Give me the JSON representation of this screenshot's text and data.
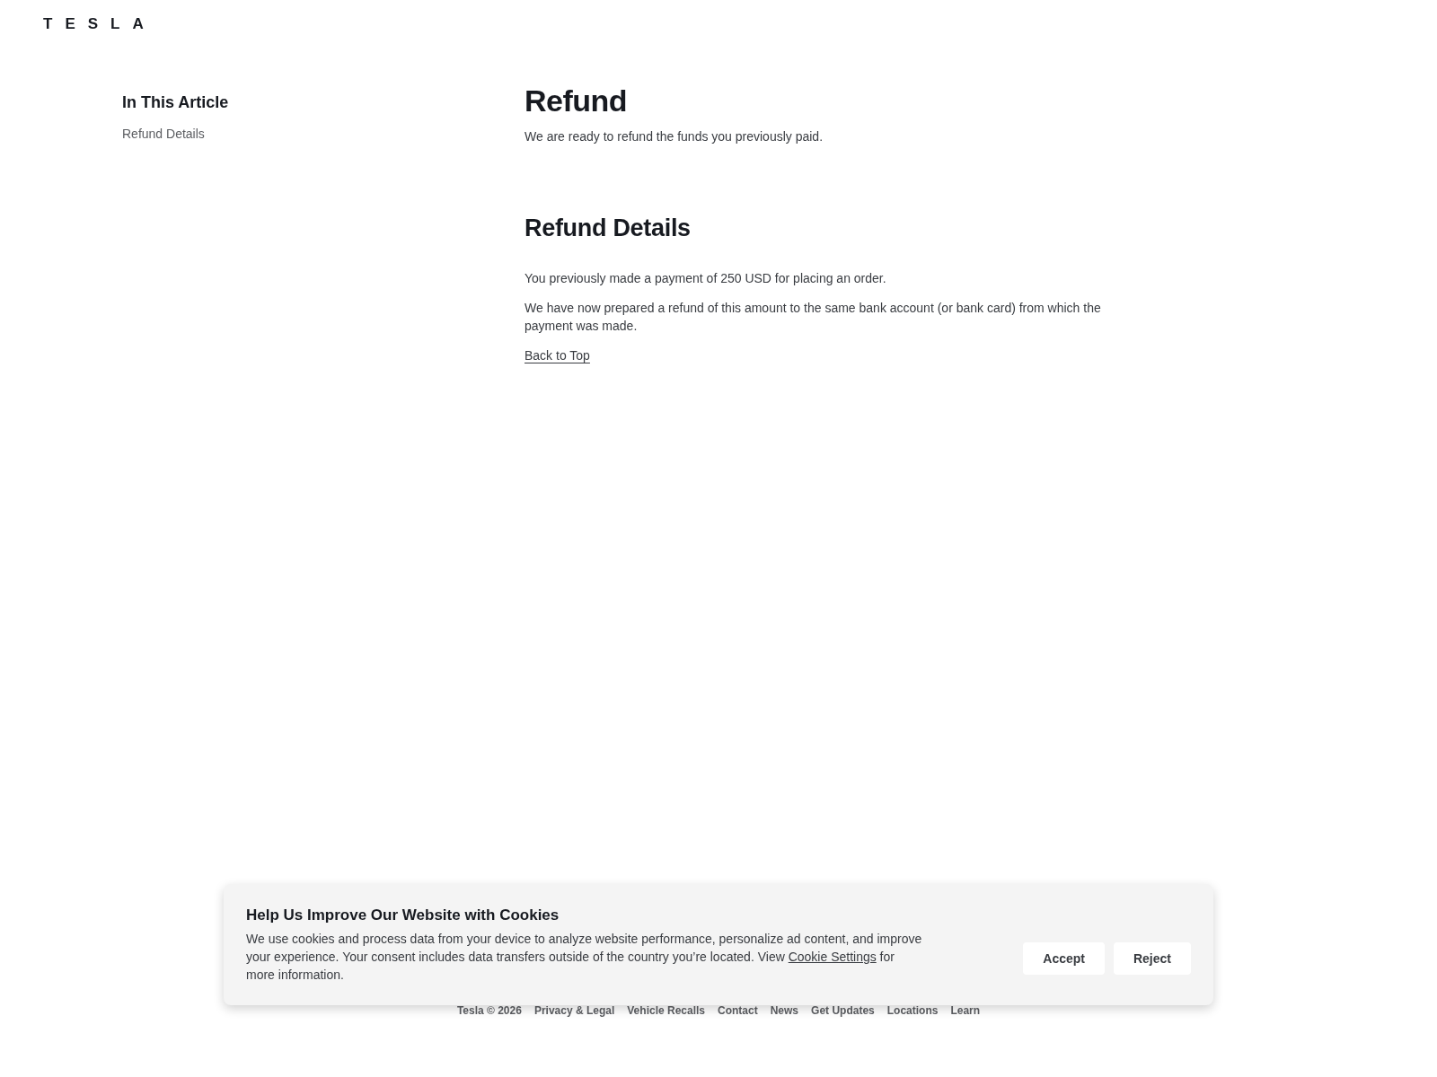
{
  "header": {
    "logo": "TESLA"
  },
  "sidebar": {
    "title": "In This Article",
    "items": [
      {
        "label": "Refund Details"
      }
    ]
  },
  "article": {
    "title": "Refund",
    "intro": "We are ready to refund the funds you previously paid.",
    "sections": [
      {
        "heading": "Refund Details",
        "paragraphs": [
          "You previously made a payment of 250 USD for placing an order.",
          "We have now prepared a refund of this amount to the same bank account (or bank card) from which the payment was made."
        ],
        "link": "Back to Top"
      }
    ]
  },
  "cookie_banner": {
    "title": "Help Us Improve Our Website with Cookies",
    "text_before": "We use cookies and process data from your device to analyze website performance, personalize ad content, and improve your experience. Your consent includes data transfers outside of the country you’re located. View",
    "link": "Cookie Settings",
    "text_after": "for more information.",
    "buttons": [
      "Accept",
      "Reject"
    ]
  },
  "footer": {
    "items": [
      "Tesla © 2026",
      "Privacy & Legal",
      "Vehicle Recalls",
      "Contact",
      "News",
      "Get Updates",
      "Locations",
      "Learn"
    ]
  }
}
